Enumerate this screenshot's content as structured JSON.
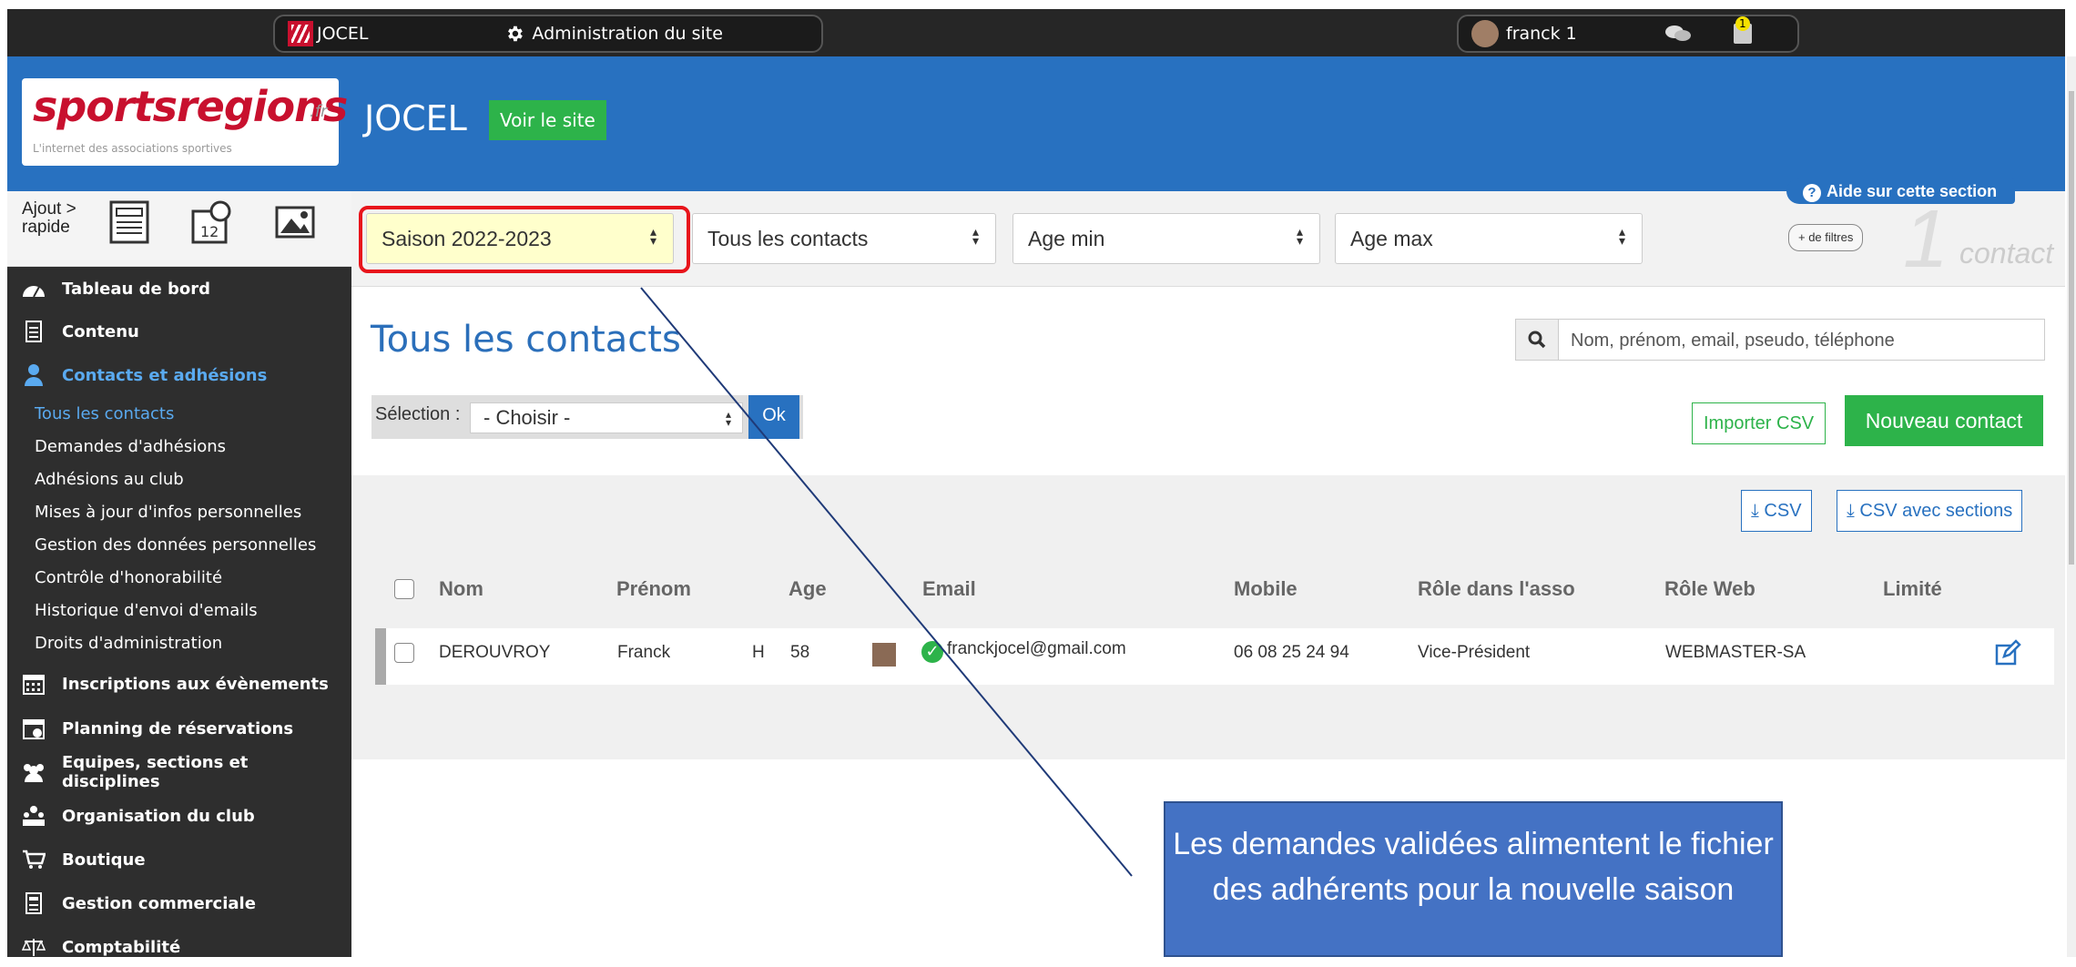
{
  "topbar": {
    "site_name": "JOCEL",
    "admin_label": "Administration du site",
    "user_name": "franck 1",
    "notification_count": "1"
  },
  "header": {
    "logo_text": "sportsregions",
    "logo_suffix": ".fr",
    "logo_tagline": "L'internet des associations sportives",
    "site_title": "JOCEL",
    "view_site_label": "Voir le site"
  },
  "quick_add": {
    "label": "Ajout > rapide"
  },
  "sidebar": {
    "items": [
      {
        "label": "Tableau de bord"
      },
      {
        "label": "Contenu"
      },
      {
        "label": "Contacts et adhésions"
      },
      {
        "label": "Inscriptions aux évènements"
      },
      {
        "label": "Planning de réservations"
      },
      {
        "label": "Equipes, sections et disciplines"
      },
      {
        "label": "Organisation du club"
      },
      {
        "label": "Boutique"
      },
      {
        "label": "Gestion commerciale"
      },
      {
        "label": "Comptabilité"
      }
    ],
    "subitems": [
      {
        "label": "Tous les contacts"
      },
      {
        "label": "Demandes d'adhésions"
      },
      {
        "label": "Adhésions au club"
      },
      {
        "label": "Mises à jour d'infos personnelles"
      },
      {
        "label": "Gestion des données personnelles"
      },
      {
        "label": "Contrôle d'honorabilité"
      },
      {
        "label": "Historique d'envoi d'emails"
      },
      {
        "label": "Droits d'administration"
      }
    ]
  },
  "filters": {
    "season": "Saison 2022-2023",
    "contacts": "Tous les contacts",
    "age_min": "Age min",
    "age_max": "Age max",
    "help_label": "Aide sur cette section",
    "more_filters": "+ de filtres",
    "count": "1",
    "count_label": "contact"
  },
  "main": {
    "title": "Tous les contacts",
    "search_placeholder": "Nom, prénom, email, pseudo, téléphone",
    "selection_label": "Sélection :",
    "selection_value": "- Choisir -",
    "ok_label": "Ok",
    "import_label": "Importer CSV",
    "new_label": "Nouveau contact",
    "csv_label": "CSV",
    "csv_sections_label": "CSV avec sections"
  },
  "table": {
    "headers": [
      "Nom",
      "Prénom",
      "Age",
      "Email",
      "Mobile",
      "Rôle dans l'asso",
      "Rôle Web",
      "Limité"
    ],
    "row": {
      "nom": "DEROUVROY",
      "prenom": "Franck",
      "sexe": "H",
      "age": "58",
      "email": "franckjocel@gmail.com",
      "mobile": "06 08 25 24 94",
      "role_asso": "Vice-Président",
      "role_web": "WEBMASTER-SA"
    }
  },
  "annotation": {
    "text": "Les demandes validées alimentent le fichier des adhérents pour la nouvelle saison"
  },
  "colors": {
    "header_blue": "#2871c0",
    "green": "#2db34a",
    "highlight_red": "#e8141b",
    "callout_blue": "#4472c4"
  }
}
